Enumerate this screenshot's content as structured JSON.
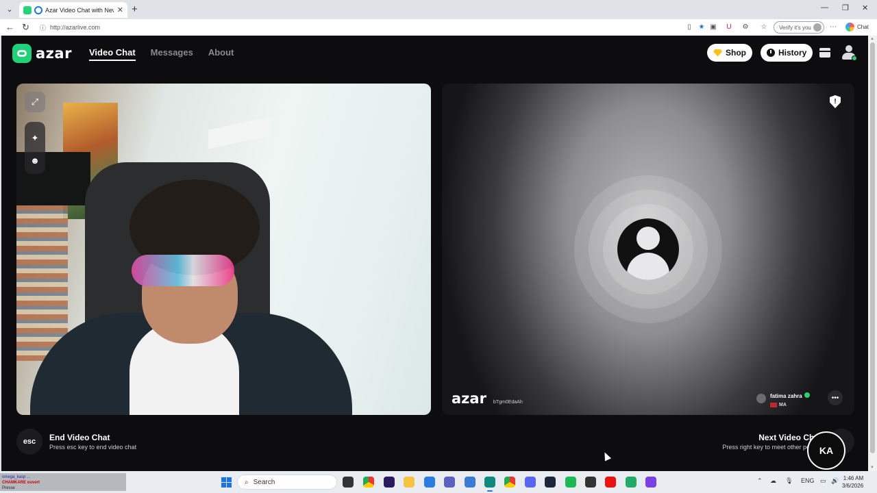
{
  "browser": {
    "tab_title": "Azar Video Chat with New Pe",
    "url": "http://azarlive.com",
    "verify_label": "Verify it's you",
    "copilot_label": "Chat"
  },
  "site": {
    "brand": "azar",
    "nav": [
      "Video Chat",
      "Messages",
      "About"
    ],
    "active_nav": "Video Chat",
    "shop_label": "Shop",
    "history_label": "History"
  },
  "remote": {
    "watermark": "azar",
    "session_id": "bTgm0EdaAh",
    "peer_name": "fatima zahra",
    "peer_country": "MA"
  },
  "controls": {
    "esc_key": "esc",
    "end_title": "End Video Chat",
    "end_hint": "Press esc key to end video chat",
    "next_title": "Next Video Chat",
    "next_hint": "Press right key to meet other people"
  },
  "taskbar": {
    "overlay_line1": "omega_kasp ...",
    "overlay_line2": "CHAMKARE ouvert",
    "overlay_line3": "Presse",
    "search_placeholder": "Search",
    "language": "ENG",
    "time": "1:46 AM",
    "date": "3/6/2026"
  },
  "colors": {
    "accent": "#1fd27a",
    "page_bg": "#0d0d0f"
  }
}
